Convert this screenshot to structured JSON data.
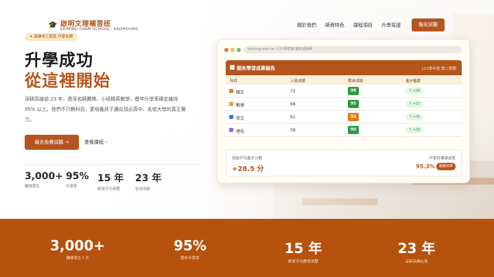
{
  "brand": {
    "name": "啟明文理補習班",
    "sub": "KEIMING CRAM SCHOOL · KAOHSIUNG"
  },
  "nav": {
    "links": [
      "關於我們",
      "師資特色",
      "課程項目",
      "升學見證"
    ],
    "cta": "報名試聽"
  },
  "hero": {
    "tag": "✦ 高雄市三民區 升學名師",
    "title_line1": "升學成功",
    "title_line2": "從這裡開始",
    "description": "深耕高雄逾 23 年，資深名師團隊、小班精英教學，歷年升學率穩定維持 95% 以上。我們不只教科目，更培養孩子邁向頂尖高中、名校大學的真正實力。",
    "primary_cta": "報名免費試聽 →",
    "secondary_cta": "查看課程 ›",
    "stats": [
      {
        "value": "3,000+",
        "label": "輔導學生"
      },
      {
        "value": "95%",
        "label": "升學率"
      },
      {
        "value": "15 年",
        "label": "師資平均資歷"
      },
      {
        "value": "23 年",
        "label": "在地深耕"
      }
    ]
  },
  "report": {
    "url": "keiming.edu.tw / 113學年度 期末成績單",
    "title": "期末學習成果報告",
    "term": "113學年度 第二學期",
    "headers": [
      "科目",
      "入班成績",
      "期末成績",
      "進步幅度"
    ],
    "rows": [
      {
        "subject": "國文",
        "start": "72",
        "final": "98",
        "gain": "↑ +26",
        "icon_color": "#d9822b",
        "score_color": "#2f9a45"
      },
      {
        "subject": "數學",
        "start": "68",
        "final": "95",
        "gain": "↑ +27",
        "icon_color": "#e0a93b",
        "score_color": "#2f9a45"
      },
      {
        "subject": "英文",
        "start": "61",
        "final": "92",
        "gain": "↑ +31",
        "icon_color": "#3a7bd5",
        "score_color": "#e07b16"
      },
      {
        "subject": "理化",
        "start": "58",
        "final": "90",
        "gain": "↑ +32",
        "icon_color": "#8a6ad8",
        "score_color": "#2f9a45"
      }
    ],
    "summary_left_label": "班級平均進步分數",
    "summary_left_value": "+28.5 分",
    "summary_right_label": "升學目標達成率",
    "summary_right_value": "95.3%",
    "summary_badge": "超越目標"
  },
  "band": {
    "stats": [
      {
        "value": "3,000+",
        "label": "輔導學生人次"
      },
      {
        "value": "95%",
        "label": "歷年升學率"
      },
      {
        "value": "15 年",
        "label": "師資平均教學資歷"
      },
      {
        "value": "23 年",
        "label": "深耕高雄在地"
      }
    ]
  },
  "colors": {
    "brand": "#b5541c",
    "band": "#b5520d"
  }
}
